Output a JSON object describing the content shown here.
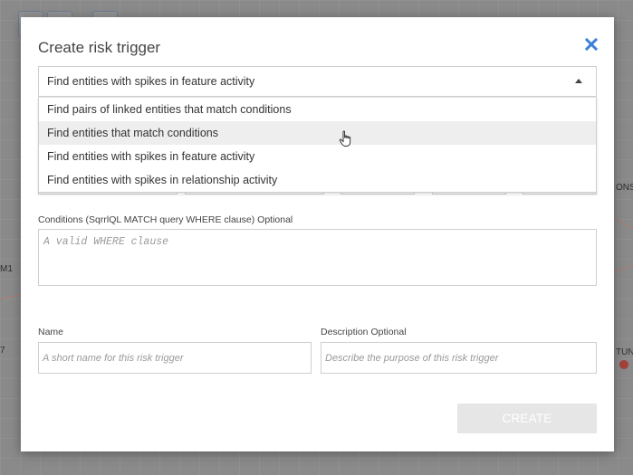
{
  "background": {
    "labels": [
      "M1",
      "7",
      "ONST",
      "TUN"
    ]
  },
  "modal": {
    "title": "Create risk trigger",
    "close_icon": "close-icon",
    "trigger_type": {
      "selected": "Find entities with spikes in feature activity",
      "options": [
        "Find pairs of linked entities that match conditions",
        "Find entities that match conditions",
        "Find entities with spikes in feature activity",
        "Find entities with spikes in relationship activity"
      ],
      "hovered_index": 1
    },
    "conditions": {
      "label": "Conditions (SqrrlQL MATCH query WHERE clause) Optional",
      "placeholder": "A valid WHERE clause"
    },
    "name": {
      "label": "Name",
      "placeholder": "A short name for this risk trigger"
    },
    "description": {
      "label": "Description Optional",
      "placeholder": "Describe the purpose of this risk trigger"
    },
    "create_label": "CREATE"
  },
  "colors": {
    "close_icon": "#3d7fd9",
    "create_button_disabled": "#e6e6e6",
    "overlay": "#8a8a8a"
  }
}
